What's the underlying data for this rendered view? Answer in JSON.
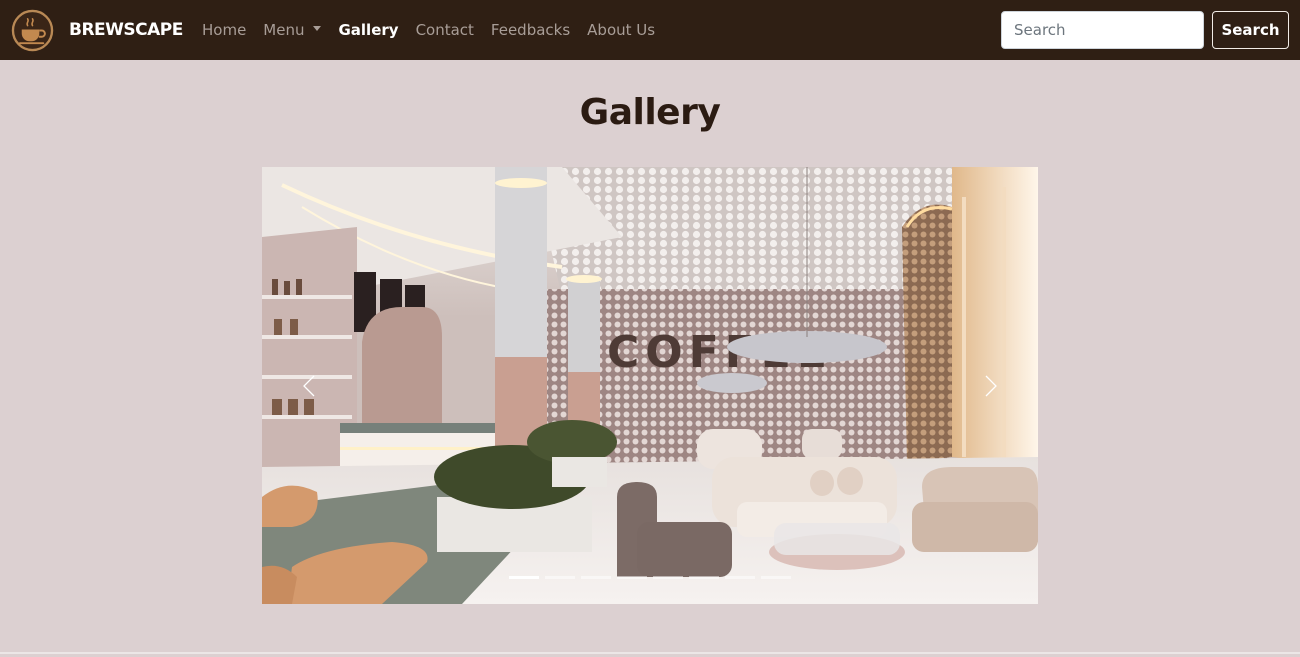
{
  "navbar": {
    "brand": "BREWSCAPE",
    "links": [
      {
        "label": "Home",
        "active": false
      },
      {
        "label": "Menu",
        "active": false,
        "dropdown": true
      },
      {
        "label": "Gallery",
        "active": true
      },
      {
        "label": "Contact",
        "active": false
      },
      {
        "label": "Feedbacks",
        "active": false
      },
      {
        "label": "About Us",
        "active": false
      }
    ],
    "search_placeholder": "Search",
    "search_button": "Search"
  },
  "page": {
    "title": "Gallery"
  },
  "carousel": {
    "slide_count": 8,
    "active_index": 0,
    "wall_text": "COFFEE"
  },
  "colors": {
    "navbar_bg": "#2f1f14",
    "page_bg": "#dcd0d1",
    "title": "#2b1b12",
    "nav_link": "#a89d97"
  },
  "icons": [
    "coffee-cup-logo-icon",
    "chevron-left-icon",
    "chevron-right-icon",
    "caret-down-icon"
  ]
}
